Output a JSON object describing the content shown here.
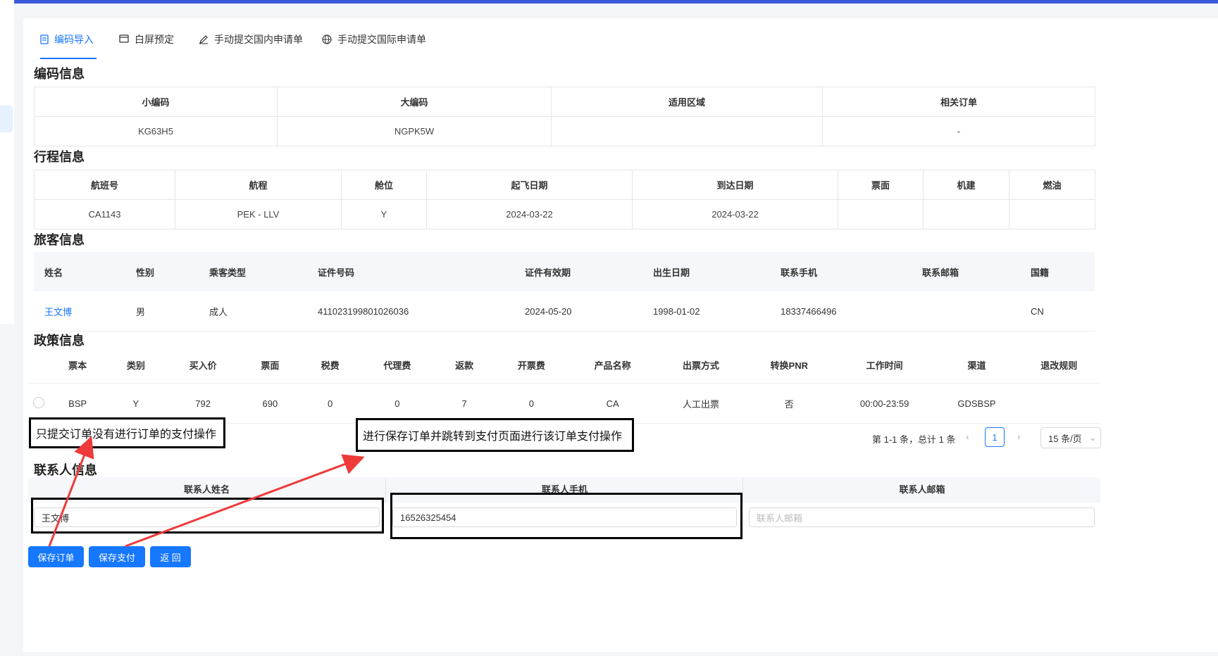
{
  "tabs": [
    {
      "label": "编码导入",
      "icon": "document-icon",
      "active": true
    },
    {
      "label": "白屏预定",
      "icon": "calendar-icon",
      "active": false
    },
    {
      "label": "手动提交国内申请单",
      "icon": "pen-icon",
      "active": false
    },
    {
      "label": "手动提交国际申请单",
      "icon": "globe-icon",
      "active": false
    }
  ],
  "code_info": {
    "title": "编码信息",
    "headers": [
      "小编码",
      "大编码",
      "适用区域",
      "相关订单"
    ],
    "row": [
      "KG63H5",
      "NGPK5W",
      "",
      "-"
    ]
  },
  "trip_info": {
    "title": "行程信息",
    "headers": [
      "航班号",
      "航程",
      "舱位",
      "起飞日期",
      "到达日期",
      "票面",
      "机建",
      "燃油"
    ],
    "row": [
      "CA1143",
      "PEK - LLV",
      "Y",
      "2024-03-22",
      "2024-03-22",
      "",
      "",
      ""
    ]
  },
  "passenger_info": {
    "title": "旅客信息",
    "headers": [
      "姓名",
      "性别",
      "乘客类型",
      "证件号码",
      "证件有效期",
      "出生日期",
      "联系手机",
      "联系邮箱",
      "国籍"
    ],
    "row": [
      "王文博",
      "男",
      "成人",
      "411023199801026036",
      "2024-05-20",
      "1998-01-02",
      "18337466496",
      "",
      "CN"
    ]
  },
  "policy_info": {
    "title": "政策信息",
    "headers": [
      "票本",
      "类别",
      "买入价",
      "票面",
      "税费",
      "代理费",
      "返款",
      "开票费",
      "产品名称",
      "出票方式",
      "转换PNR",
      "工作时间",
      "渠道",
      "退改规则"
    ],
    "row": [
      "BSP",
      "Y",
      "792",
      "690",
      "0",
      "0",
      "7",
      "0",
      "CA",
      "人工出票",
      "否",
      "00:00-23:59",
      "GDSBSP",
      ""
    ]
  },
  "pagination": {
    "summary": "第 1-1 条，总计 1 条",
    "current_page": "1",
    "page_size": "15 条/页"
  },
  "contact_info": {
    "title": "联系人信息",
    "headers": [
      "联系人姓名",
      "联系人手机",
      "联系人邮箱"
    ],
    "name_value": "王文博",
    "phone_value": "16526325454",
    "email_placeholder": "联系人邮箱"
  },
  "buttons": {
    "save_order": "保存订单",
    "save_pay": "保存支付",
    "back": "返 回"
  },
  "annotations": {
    "left": "只提交订单没有进行订单的支付操作",
    "right": "进行保存订单并跳转到支付页面进行该订单支付操作"
  },
  "colors": {
    "primary": "#1677ff",
    "topbar": "#3a5bd9",
    "arrow": "#ee3a3a"
  }
}
